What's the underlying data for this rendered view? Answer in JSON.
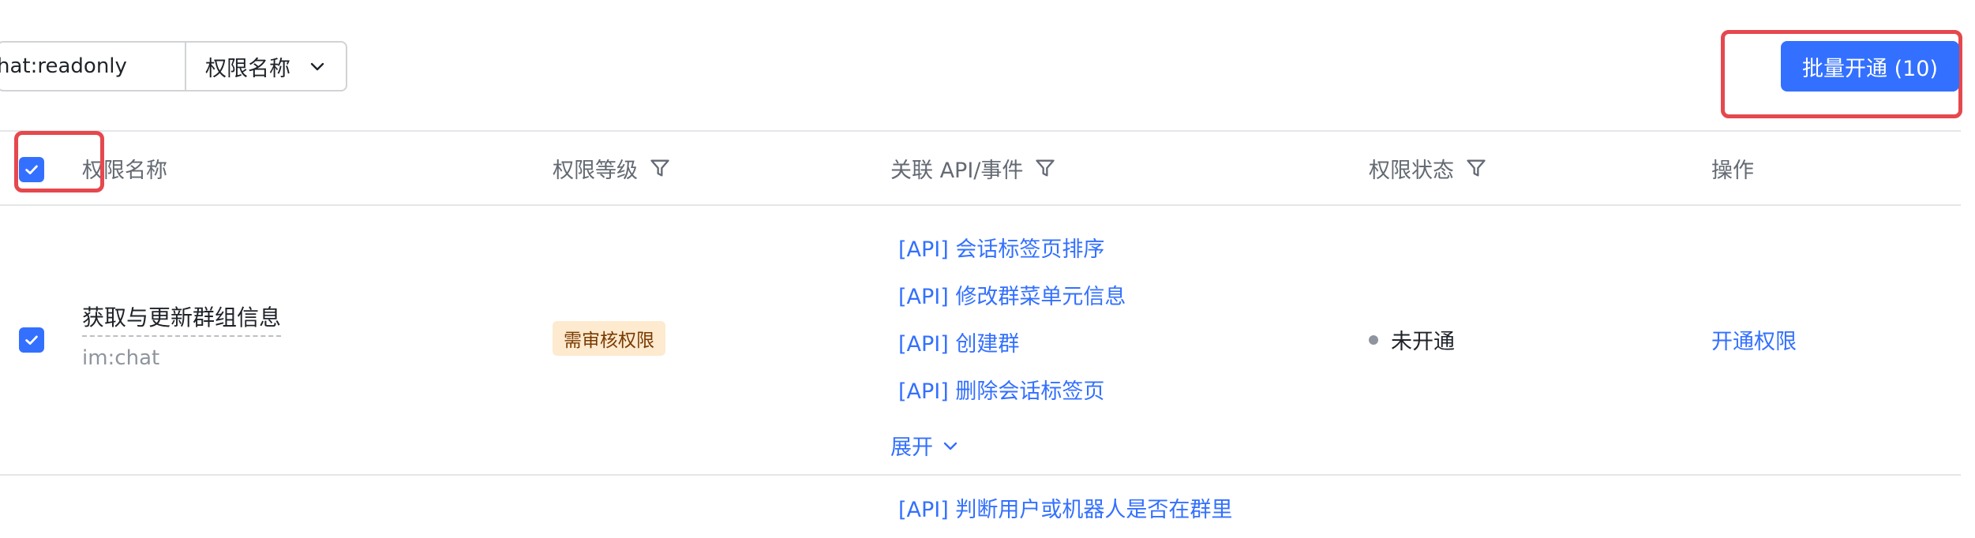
{
  "search": {
    "value": "hat:readonly",
    "placeholder": "chat:readonly"
  },
  "filter_select": {
    "value": "权限名称"
  },
  "batch_button": {
    "label": "批量开通 (10)"
  },
  "table": {
    "columns": {
      "name": "权限名称",
      "level": "权限等级",
      "api": "关联 API/事件",
      "status": "权限状态",
      "action": "操作"
    },
    "rows": [
      {
        "selected": true,
        "name": "获取与更新群组信息",
        "key": "im:chat",
        "level_tag": "需审核权限",
        "apis": [
          "[API] 会话标签页排序",
          "[API] 修改群菜单元信息",
          "[API] 创建群",
          "[API] 删除会话标签页"
        ],
        "expand_label": "展开",
        "status": "未开通",
        "action": "开通权限"
      }
    ],
    "next_row_first_api": "[API] 判断用户或机器人是否在群里"
  },
  "colors": {
    "accent": "#3370ff",
    "highlight": "#e5484d",
    "tag_bg": "#fdeacf"
  }
}
